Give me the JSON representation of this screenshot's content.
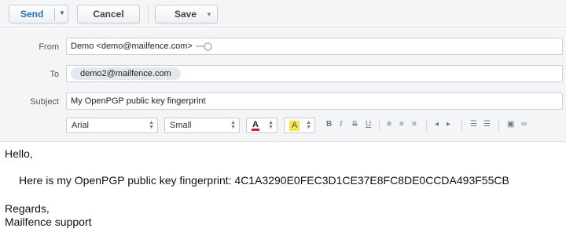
{
  "toolbar": {
    "send_label": "Send",
    "cancel_label": "Cancel",
    "save_label": "Save"
  },
  "header": {
    "from_label": "From",
    "from_value": "Demo <demo@mailfence.com>",
    "to_label": "To",
    "to_recipients": [
      "demo2@mailfence.com"
    ],
    "subject_label": "Subject",
    "subject_value": "My OpenPGP public key fingerprint"
  },
  "format_bar": {
    "font_family": "Arial",
    "font_size": "Small",
    "text_color_glyph": "A",
    "highlight_glyph": "A",
    "bold": "B",
    "italic": "I",
    "strike": "S",
    "underline": "U"
  },
  "body": {
    "greeting": "Hello,",
    "line": "Here is my OpenPGP public key fingerprint: 4C1A3290E0FEC3D1CE37E8FC8DE0CCDA493F55CB",
    "closing": "Regards,",
    "signature": "Mailfence support"
  },
  "colors": {
    "accent": "#2f6db5",
    "text_color_bar": "#c0262c",
    "highlight_bg": "#f5e64a"
  }
}
